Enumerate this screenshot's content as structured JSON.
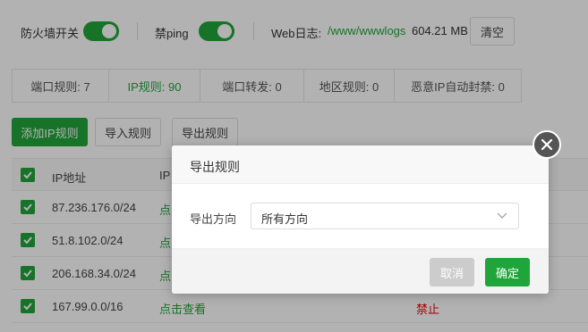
{
  "toolbar": {
    "firewall_label": "防火墙开关",
    "ping_label": "禁ping",
    "weblog_label": "Web日志:",
    "weblog_path": "/www/wwwlogs",
    "weblog_size": "604.21 MB",
    "clear_label": "清空"
  },
  "tabs": [
    {
      "label": "端口规则: 7",
      "active": false
    },
    {
      "label": "IP规则: 90",
      "active": true
    },
    {
      "label": "端口转发: 0",
      "active": false
    },
    {
      "label": "地区规则: 0",
      "active": false
    },
    {
      "label": "恶意IP自动封禁: 0",
      "active": false
    }
  ],
  "actions": {
    "add_ip_rule": "添加IP规则",
    "import_rules": "导入规则",
    "export_rules": "导出规则"
  },
  "table": {
    "headers": {
      "ip": "IP地址",
      "col2": "IP"
    },
    "rows": [
      {
        "ip": "87.236.176.0/24",
        "view": "点",
        "status": ""
      },
      {
        "ip": "51.8.102.0/24",
        "view": "点",
        "status": ""
      },
      {
        "ip": "206.168.34.0/24",
        "view": "点",
        "status": ""
      },
      {
        "ip": "167.99.0.0/16",
        "view": "点击查看",
        "status": "禁止"
      }
    ]
  },
  "dialog": {
    "title": "导出规则",
    "field_label": "导出方向",
    "select_value": "所有方向",
    "cancel_label": "取消",
    "confirm_label": "确定"
  },
  "colors": {
    "accent": "#20a53a",
    "danger": "#e00000"
  }
}
